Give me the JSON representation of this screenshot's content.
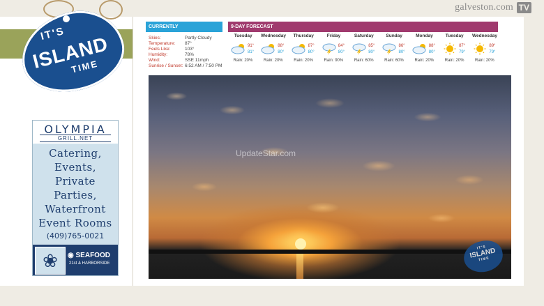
{
  "brand": {
    "site": "galveston.com",
    "tv": "TV"
  },
  "logo": {
    "line1": "IT'S",
    "line2": "ISLAND",
    "line3": "TIME"
  },
  "ad": {
    "name": "OLYMPIA",
    "sub": "GRILL.NET",
    "lines": [
      "Catering,",
      "Events,",
      "Private",
      "Parties,",
      "Waterfront",
      "Event Rooms"
    ],
    "phone": "(409)765-0021",
    "seafood": "SEAFOOD",
    "address": "21st & HARBORSIDE"
  },
  "currently": {
    "header": "CURRENTLY",
    "rows": [
      {
        "label": "Skies:",
        "value": "Partly Cloudy"
      },
      {
        "label": "Temperature:",
        "value": "87°"
      },
      {
        "label": "Feels Like:",
        "value": "103°"
      },
      {
        "label": "Humidity:",
        "value": "78%"
      },
      {
        "label": "Wind:",
        "value": "SSE 11mph"
      },
      {
        "label": "Sunrise / Sunset:",
        "value": "6:52 AM / 7:50 PM"
      }
    ]
  },
  "forecast": {
    "header": "9-DAY FORECAST",
    "days": [
      {
        "name": "Tuesday",
        "icon": "partly-cloudy-icon",
        "hi": "91°",
        "lo": "81°",
        "rain": "Rain: 20%"
      },
      {
        "name": "Wednesday",
        "icon": "partly-cloudy-icon",
        "hi": "88°",
        "lo": "80°",
        "rain": "Rain: 20%"
      },
      {
        "name": "Thursday",
        "icon": "partly-cloudy-icon",
        "hi": "87°",
        "lo": "80°",
        "rain": "Rain: 20%"
      },
      {
        "name": "Friday",
        "icon": "thunderstorm-icon",
        "hi": "84°",
        "lo": "80°",
        "rain": "Rain: 90%"
      },
      {
        "name": "Saturday",
        "icon": "thunderstorm-icon",
        "hi": "85°",
        "lo": "80°",
        "rain": "Rain: 60%"
      },
      {
        "name": "Sunday",
        "icon": "thunderstorm-icon",
        "hi": "86°",
        "lo": "80°",
        "rain": "Rain: 60%"
      },
      {
        "name": "Monday",
        "icon": "partly-cloudy-icon",
        "hi": "88°",
        "lo": "80°",
        "rain": "Rain: 20%"
      },
      {
        "name": "Tuesday",
        "icon": "sunny-icon",
        "hi": "87°",
        "lo": "79°",
        "rain": "Rain: 20%"
      },
      {
        "name": "Wednesday",
        "icon": "sunny-icon",
        "hi": "89°",
        "lo": "79°",
        "rain": "Rain: 20%"
      }
    ]
  },
  "photo": {
    "watermark": "UpdateStar.com",
    "tag_line1": "IT'S",
    "tag_line2": "ISLAND",
    "tag_line3": "TIME"
  }
}
